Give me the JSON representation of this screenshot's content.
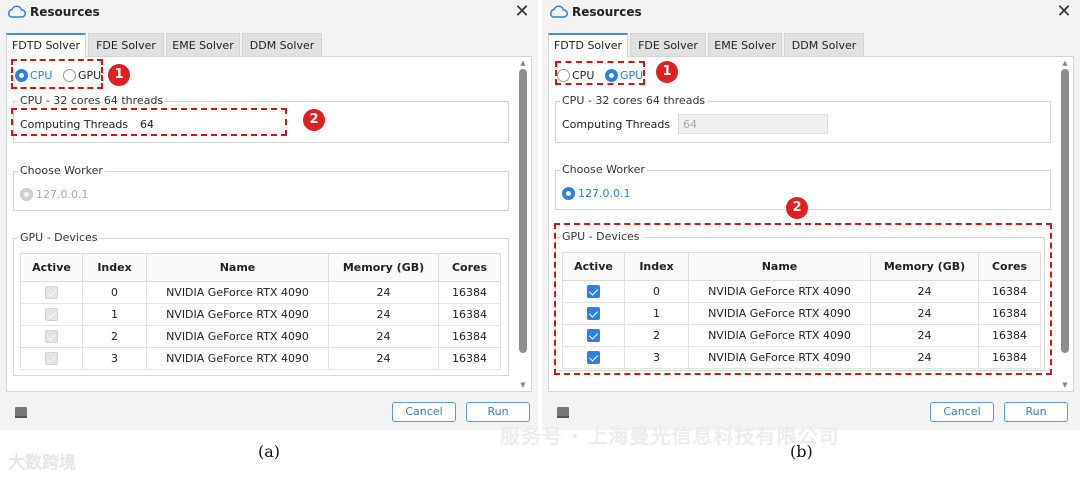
{
  "panels": [
    {
      "caption": "(a)",
      "window_title": "Resources",
      "tabs": [
        "FDTD Solver",
        "FDE Solver",
        "EME Solver",
        "DDM Solver"
      ],
      "active_tab": "FDTD Solver",
      "device_options": {
        "cpu_label": "CPU",
        "gpu_label": "GPU",
        "selected": "CPU"
      },
      "cpu_group": {
        "title": "CPU - 32 cores 64 threads",
        "threads_label": "Computing Threads",
        "threads_value": "64",
        "threads_enabled": true
      },
      "worker_group": {
        "title": "Choose Worker",
        "worker": "127.0.0.1",
        "enabled": false
      },
      "gpu_group": {
        "title": "GPU - Devices",
        "columns": [
          "Active",
          "Index",
          "Name",
          "Memory (GB)",
          "Cores"
        ],
        "rows": [
          {
            "active": true,
            "index": "0",
            "name": "NVIDIA GeForce RTX 4090",
            "memory": "24",
            "cores": "16384"
          },
          {
            "active": true,
            "index": "1",
            "name": "NVIDIA GeForce RTX 4090",
            "memory": "24",
            "cores": "16384"
          },
          {
            "active": true,
            "index": "2",
            "name": "NVIDIA GeForce RTX 4090",
            "memory": "24",
            "cores": "16384"
          },
          {
            "active": true,
            "index": "3",
            "name": "NVIDIA GeForce RTX 4090",
            "memory": "24",
            "cores": "16384"
          }
        ],
        "enabled": false
      },
      "buttons": {
        "cancel": "Cancel",
        "run": "Run"
      },
      "markers": [
        "1",
        "2"
      ]
    },
    {
      "caption": "(b)",
      "window_title": "Resources",
      "tabs": [
        "FDTD Solver",
        "FDE Solver",
        "EME Solver",
        "DDM Solver"
      ],
      "active_tab": "FDTD Solver",
      "device_options": {
        "cpu_label": "CPU",
        "gpu_label": "GPU",
        "selected": "GPU"
      },
      "cpu_group": {
        "title": "CPU - 32 cores 64 threads",
        "threads_label": "Computing Threads",
        "threads_value": "64",
        "threads_enabled": false
      },
      "worker_group": {
        "title": "Choose Worker",
        "worker": "127.0.0.1",
        "enabled": true
      },
      "gpu_group": {
        "title": "GPU - Devices",
        "columns": [
          "Active",
          "Index",
          "Name",
          "Memory (GB)",
          "Cores"
        ],
        "rows": [
          {
            "active": true,
            "index": "0",
            "name": "NVIDIA GeForce RTX 4090",
            "memory": "24",
            "cores": "16384"
          },
          {
            "active": true,
            "index": "1",
            "name": "NVIDIA GeForce RTX 4090",
            "memory": "24",
            "cores": "16384"
          },
          {
            "active": true,
            "index": "2",
            "name": "NVIDIA GeForce RTX 4090",
            "memory": "24",
            "cores": "16384"
          },
          {
            "active": true,
            "index": "3",
            "name": "NVIDIA GeForce RTX 4090",
            "memory": "24",
            "cores": "16384"
          }
        ],
        "enabled": true
      },
      "buttons": {
        "cancel": "Cancel",
        "run": "Run"
      },
      "markers": [
        "1",
        "2"
      ]
    }
  ],
  "watermarks": {
    "left_logo": "大数跨境",
    "right_text": "服务号 · 上海曼光信息科技有限公司"
  },
  "colors": {
    "accent": "#2e7fe3",
    "highlight": "#d01818",
    "marker": "#e02020",
    "window_bg": "#f3f3f3"
  }
}
